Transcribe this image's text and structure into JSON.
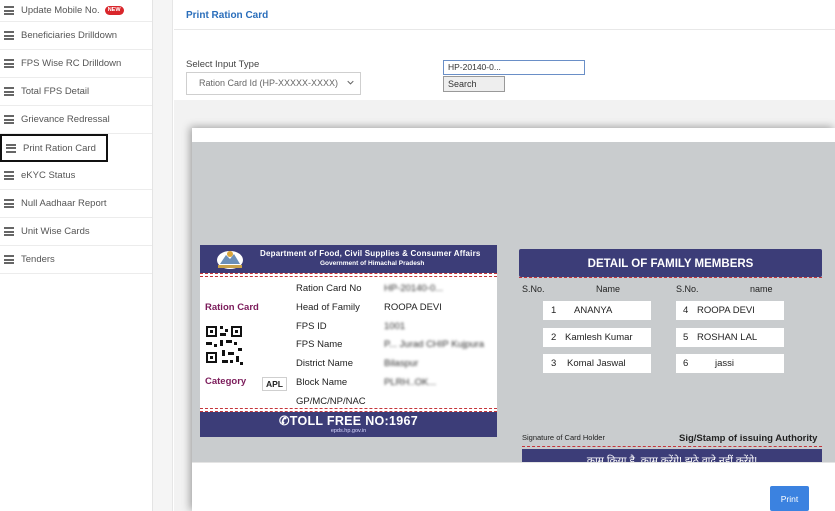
{
  "sidebar": {
    "items": [
      {
        "label": "Update Mobile No.",
        "badge": "NEW"
      },
      {
        "label": "Beneficiaries Drilldown"
      },
      {
        "label": "FPS Wise RC Drilldown"
      },
      {
        "label": "Total FPS Detail"
      },
      {
        "label": "Grievance Redressal"
      },
      {
        "label": "Print Ration Card"
      },
      {
        "label": "eKYC Status"
      },
      {
        "label": "Null Aadhaar Report"
      },
      {
        "label": "Unit Wise Cards"
      },
      {
        "label": "Tenders"
      }
    ],
    "active_index": 5
  },
  "panel": {
    "title": "Print Ration Card",
    "input_type_label": "Select Input Type",
    "select_value": "Ration Card Id (HP-XXXXX-XXXX)",
    "search_value": "HP-20140-0...",
    "search_button": "Search"
  },
  "card": {
    "dept_title": "Department of Food, Civil Supplies & Consumer Affairs",
    "dept_subtitle": "Government of Himachal Pradesh",
    "ration_card_label": "Ration Card",
    "category_label": "Category",
    "category_value": "APL",
    "fields": [
      {
        "label": "Ration Card No",
        "value": "HP-20140-0..."
      },
      {
        "label": "Head of Family",
        "value": "ROOPA DEVI"
      },
      {
        "label": "FPS ID",
        "value": "1001"
      },
      {
        "label": "FPS Name",
        "value": "P... Jurad CHIP Kujpura"
      },
      {
        "label": "District Name",
        "value": "Bilaspur"
      },
      {
        "label": "Block Name",
        "value": "PLRH..OK..."
      },
      {
        "label": "GP/MC/NP/NAC",
        "value": ""
      }
    ],
    "toll_free": "TOLL FREE NO:1967",
    "toll_prefix_icon": "phone-icon",
    "website": "epds.hp.gov.in"
  },
  "family": {
    "header": "DETAIL OF FAMILY MEMBERS",
    "sno_label": "S.No.",
    "name_label": "Name",
    "sno_label_2": "S.No.",
    "name_label_2": "name",
    "members": [
      {
        "no": "1",
        "name": "ANANYA"
      },
      {
        "no": "2",
        "name": "Kamlesh Kumar"
      },
      {
        "no": "3",
        "name": "Komal Jaswal"
      },
      {
        "no": "4",
        "name": "ROOPA DEVI"
      },
      {
        "no": "5",
        "name": "ROSHAN LAL"
      },
      {
        "no": "6",
        "name": "jassi"
      }
    ],
    "signature_holder": "Signature of Card Holder",
    "signature_authority": "Sig/Stamp of issuing Authority",
    "slogan": "काम किया है, काम करेंगे! झूठे वादे नहीं करेंगे!"
  },
  "footer": {
    "print_button": "Print"
  },
  "colors": {
    "accent": "#2a6ebb",
    "banner": "#3c3d78",
    "label_maroon": "#7b1b5a",
    "print_button": "#3b82e0",
    "badge_red": "#d9262b"
  }
}
